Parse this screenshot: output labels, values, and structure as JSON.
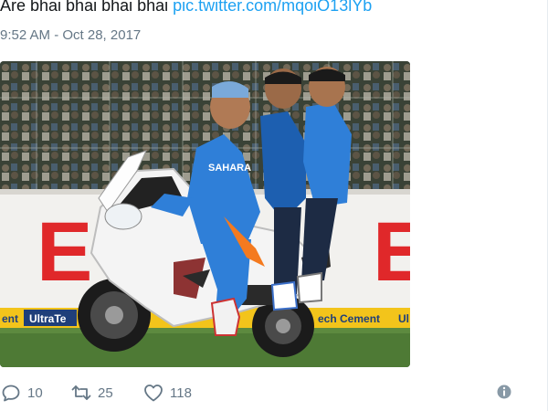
{
  "tweet": {
    "text": "Are bhai bhai bhai bhai ",
    "link": "pic.twitter.com/mqoiO13lYb",
    "timestamp": "9:52 AM - Oct 28, 2017"
  },
  "media": {
    "banner_left": "E",
    "banner_right": "E",
    "jersey_text": "SAHARA",
    "ad_1": "UltraTe",
    "ad_2": "ech Cement",
    "ad_left": "ent",
    "ad_right": "Ul"
  },
  "actions": {
    "reply_count": "10",
    "retweet_count": "25",
    "like_count": "118"
  },
  "colors": {
    "link": "#1da1f2",
    "muted": "#657786",
    "jersey_blue": "#2f7fd8"
  },
  "icons": [
    "reply-icon",
    "retweet-icon",
    "like-icon",
    "more-icon"
  ]
}
